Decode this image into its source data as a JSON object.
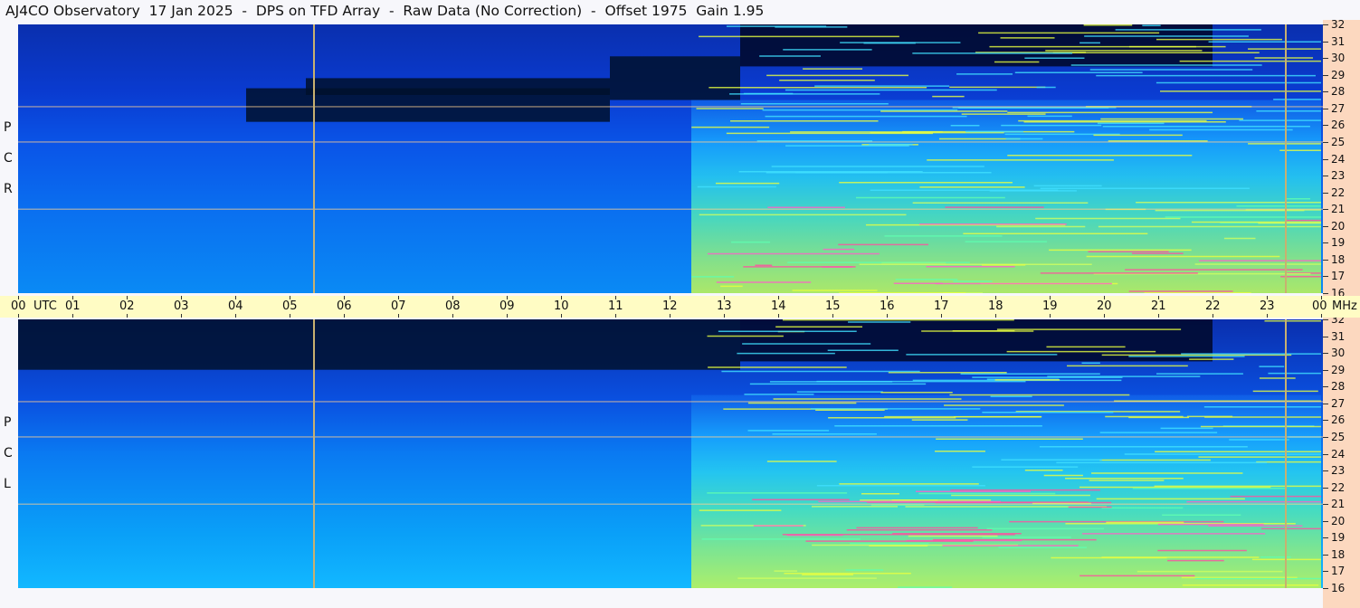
{
  "title": "AJ4CO Observatory  17 Jan 2025  -  DPS on TFD Array  -  Raw Data (No Correction)  -  Offset 1975  Gain 1.95",
  "panels": [
    {
      "id": "rcp",
      "letters": [
        "P",
        "C",
        "R"
      ]
    },
    {
      "id": "lcp",
      "letters": [
        "P",
        "C",
        "L"
      ]
    }
  ],
  "time_axis": {
    "labels": [
      "00",
      "01",
      "02",
      "03",
      "04",
      "05",
      "06",
      "07",
      "08",
      "09",
      "10",
      "11",
      "12",
      "13",
      "14",
      "15",
      "16",
      "17",
      "18",
      "19",
      "20",
      "21",
      "22",
      "23",
      "00"
    ],
    "utc_label": "UTC",
    "mhz_label": "MHz"
  },
  "chart_data": {
    "type": "heatmap",
    "title": "AJ4CO Observatory  17 Jan 2025  -  DPS on TFD Array  -  Raw Data (No Correction)  -  Offset 1975  Gain 1.95",
    "x_unit": "UTC hour",
    "xlim": [
      0,
      24
    ],
    "y_unit": "MHz",
    "ylim": [
      16,
      32
    ],
    "freq_ticks": [
      32,
      31,
      30,
      29,
      28,
      27,
      26,
      25,
      24,
      23,
      22,
      21,
      20,
      19,
      18,
      17,
      16
    ],
    "polarizations": [
      "RCP",
      "LCP"
    ],
    "colormap": [
      "#000000",
      "#001a66",
      "#0040e0",
      "#0a8cff",
      "#1cd0ff",
      "#60f0a0",
      "#d8ff40",
      "#ff4080"
    ],
    "vertical_markers_utc": [
      5.45,
      23.35
    ],
    "intensity_regions_note_free": true
  }
}
